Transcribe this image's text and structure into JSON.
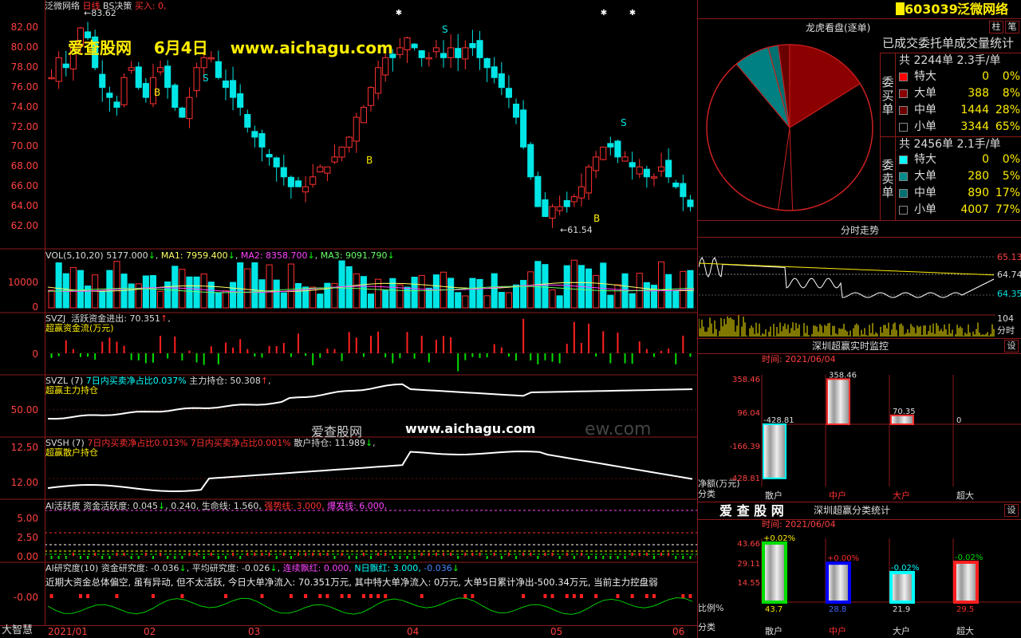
{
  "title_bar": {
    "indicator": "泛微网络",
    "daily": "日线",
    "bs": "BS决策",
    "buy": "买入: 0,"
  },
  "price_axis": [
    "82.00",
    "80.00",
    "78.00",
    "76.00",
    "74.00",
    "72.00",
    "70.00",
    "68.00",
    "66.00",
    "64.00",
    "62.00"
  ],
  "price_notes": {
    "high": "83.62",
    "low": "61.54"
  },
  "signals": {
    "b": "B",
    "s": "S"
  },
  "watermark": {
    "site": "爱查股网",
    "date": "6月4日",
    "url": "www.aichagu.com",
    "ghost": "ew.com"
  },
  "vol": {
    "label": "VOL(5,10,20)",
    "v": "5177.000",
    "ma1": "MA1: 7959.400",
    "ma2": "MA2: 8358.700",
    "ma3": "MA3: 9091.790",
    "axis": [
      "10000",
      "0"
    ]
  },
  "svzj": {
    "label": "SVZJ",
    "t1": "活跃资金进出: 70.351",
    "name": "超赢资金流(万元)",
    "axis": [
      "0"
    ]
  },
  "svzl": {
    "label": "SVZL (7)",
    "t1": "7日内买卖净占比0.037%",
    "t2": "主力持仓: 50.308",
    "name": "超赢主力持仓",
    "axis": [
      "50.00"
    ]
  },
  "svsh": {
    "label": "SVSH (7)",
    "t1": "7日内买卖净占比0.013%",
    "t2": "7日内买卖净占比0.001%",
    "t3": "散户持仓: 11.989",
    "name": "超赢散户持仓",
    "axis": [
      "12.50",
      "12.00"
    ]
  },
  "ai1": {
    "label": "AI活跃度",
    "t1": "资金活跃度: 0.045",
    "t2": "0.240",
    "t3": "生命线: 1.560,",
    "t4": "强势线: 3.000,",
    "t5": "爆发线: 6.000,",
    "axis": [
      "5.00",
      "2.50",
      "0.00"
    ]
  },
  "ai2": {
    "label": "AI研究度(10)",
    "t1": "资金研究度: -0.036",
    "t2": "平均研究度: -0.026",
    "t3": "连续飘红: 0.000,",
    "t4": "N日飘红: 3.000,",
    "t5": "-0.036",
    "comment": "近期大资金总体偏空, 虽有异动, 但不太活跃, 今日大单净流入: 70.351万元, 其中特大单净流入: 0万元, 大单5日累计净出-500.34万元, 当前主力控盘弱",
    "axis": [
      "-0.00"
    ]
  },
  "dates": [
    "2021/01",
    "02",
    "03",
    "04",
    "05",
    "06"
  ],
  "brand": "大智慧",
  "header": {
    "code": "603039",
    "name": "泛微网络",
    "btn1": "柱",
    "btn2": "笔"
  },
  "dragon": {
    "title": "龙虎看盘(逐单)",
    "sub": "已成交委托单成交量统计",
    "buy": {
      "side": "委买单",
      "total": "共 2244单 2.3手/单",
      "rows": [
        [
          "特大",
          "0",
          "0%"
        ],
        [
          "大单",
          "388",
          "8%"
        ],
        [
          "中单",
          "1444",
          "28%"
        ],
        [
          "小单",
          "3344",
          "65%"
        ]
      ]
    },
    "sell": {
      "side": "委卖单",
      "total": "共 2456单 2.1手/单",
      "rows": [
        [
          "特大",
          "0",
          "0%"
        ],
        [
          "大单",
          "280",
          "5%"
        ],
        [
          "中单",
          "890",
          "17%"
        ],
        [
          "小单",
          "4007",
          "77%"
        ]
      ]
    }
  },
  "intraday": {
    "title": "分时走势",
    "axis": [
      "65.13",
      "64.74",
      "64.35",
      "104"
    ],
    "tag": "分时"
  },
  "monitor": {
    "title": "深圳超赢实时监控",
    "btn": "设",
    "time": "时间: 2021/06/04",
    "axis": [
      "358.46",
      "96.04",
      "-166.39",
      "-428.81"
    ],
    "vals": [
      "-428.81",
      "358.46",
      "70.35",
      "0"
    ],
    "ylabel": "净额(万元)",
    "xlabel": "分类",
    "cats": [
      "散户",
      "中户",
      "大户",
      "超大"
    ]
  },
  "classify": {
    "brand": "爱 查 股 网",
    "title": "深圳超赢分类统计",
    "btn": "设",
    "time": "时间: 2021/06/04",
    "axis": [
      "43.66",
      "29.11",
      "14.55"
    ],
    "tops": [
      "+0.02%",
      "+0.00%",
      "-0.02%",
      "-0.02%"
    ],
    "vals": [
      "43.7",
      "28.8",
      "21.9",
      "29.5"
    ],
    "ylabel": "比例%",
    "xlabel": "分类",
    "cats": [
      "散户",
      "中户",
      "大户",
      "超大"
    ]
  },
  "chart_data": [
    {
      "type": "bar",
      "title": "深圳超赢实时监控",
      "categories": [
        "散户",
        "中户",
        "大户",
        "超大"
      ],
      "values": [
        -428.81,
        358.46,
        70.35,
        0
      ],
      "ylim": [
        -428.81,
        358.46
      ]
    },
    {
      "type": "bar",
      "title": "深圳超赢分类统计",
      "categories": [
        "散户",
        "中户",
        "大户",
        "超大"
      ],
      "values": [
        43.7,
        28.8,
        21.9,
        29.5
      ],
      "ylim": [
        0,
        43.66
      ]
    },
    {
      "type": "pie",
      "title": "龙虎看盘(逐单)",
      "categories": [
        "委买特大",
        "委买大单",
        "委买中单",
        "委买小单"
      ],
      "values": [
        0,
        8,
        28,
        65
      ]
    }
  ]
}
